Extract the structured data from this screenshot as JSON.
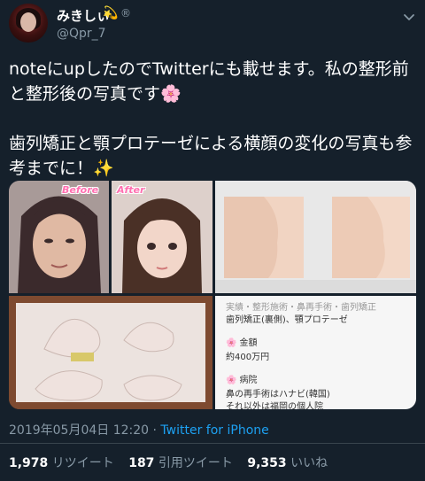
{
  "user": {
    "display_name": "みきしぃ",
    "badge_icon": "wave-icon",
    "badge_glyph": "💫",
    "registered_mark": "®",
    "handle": "@Qpr_7"
  },
  "tweet": {
    "text": "noteにupしたのでTwitterにも載せます。私の整形前と整形後の写真です🌸\n\n歯列矯正と顎プロテーゼによる横顔の変化の写真も参考までに！✨"
  },
  "media": {
    "before_tag": "Before",
    "after_tag": "After",
    "doc_line_1": "歯列矯正(裏側)、顎プロテーゼ",
    "doc_heading_2": "金額",
    "doc_line_2": "約400万円",
    "doc_heading_3": "病院",
    "doc_line_3a": "鼻の再手術はハナビ(韓国)",
    "doc_line_3b": "それ以外は福岡の個人院"
  },
  "meta": {
    "timestamp": "2019年05月04日 12:20",
    "separator": "·",
    "source": "Twitter for iPhone"
  },
  "stats": {
    "retweets_count": "1,978",
    "retweets_label": "リツイート",
    "quotes_count": "187",
    "quotes_label": "引用ツイート",
    "likes_count": "9,353",
    "likes_label": "いいね"
  },
  "colors": {
    "background": "#15202b",
    "secondary_text": "#8899a6",
    "link": "#1da1f2",
    "divider": "#38444d"
  }
}
